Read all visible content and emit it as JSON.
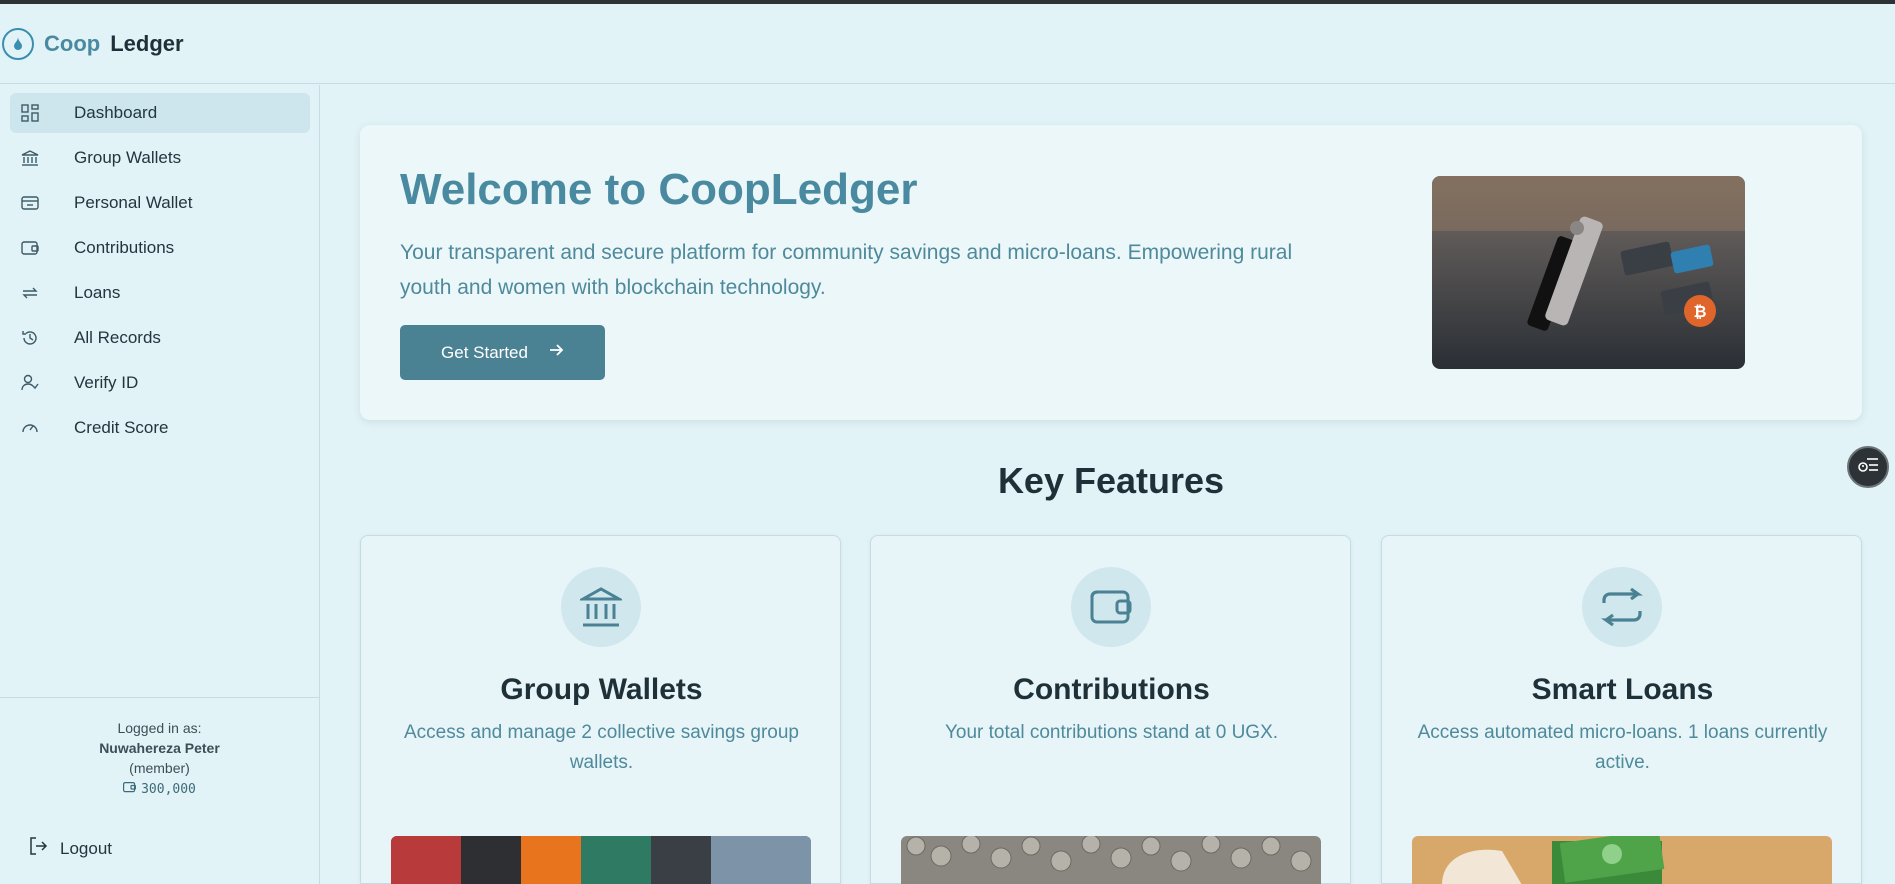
{
  "app": {
    "brand_part1": "Coop",
    "brand_part2": "Ledger"
  },
  "sidebar": {
    "items": [
      {
        "label": "Dashboard",
        "icon": "dashboard-icon",
        "active": true
      },
      {
        "label": "Group Wallets",
        "icon": "bank-icon"
      },
      {
        "label": "Personal Wallet",
        "icon": "wallet-icon"
      },
      {
        "label": "Contributions",
        "icon": "wallet-cards-icon"
      },
      {
        "label": "Loans",
        "icon": "repeat-icon"
      },
      {
        "label": "All Records",
        "icon": "history-icon"
      },
      {
        "label": "Verify ID",
        "icon": "user-check-icon"
      },
      {
        "label": "Credit Score",
        "icon": "gauge-icon"
      }
    ],
    "footer": {
      "logged_in_label": "Logged in as:",
      "user_name": "Nuwahereza Peter",
      "role": "(member)",
      "balance": "300,000",
      "logout_label": "Logout"
    }
  },
  "hero": {
    "title": "Welcome to CoopLedger",
    "description": "Your transparent and secure platform for community savings and micro-loans. Empowering rural youth and women with blockchain technology.",
    "button_label": "Get Started"
  },
  "features": {
    "title": "Key Features",
    "cards": [
      {
        "title": "Group Wallets",
        "description": "Access and manage 2 collective savings group wallets.",
        "icon": "bank-icon"
      },
      {
        "title": "Contributions",
        "description": "Your total contributions stand at 0 UGX.",
        "icon": "wallet-icon"
      },
      {
        "title": "Smart Loans",
        "description": "Access automated micro-loans. 1 loans currently active.",
        "icon": "repeat-icon"
      }
    ]
  },
  "colors": {
    "accent": "#4a8aa0",
    "button": "#4a8193",
    "background": "#e2f3f7"
  }
}
